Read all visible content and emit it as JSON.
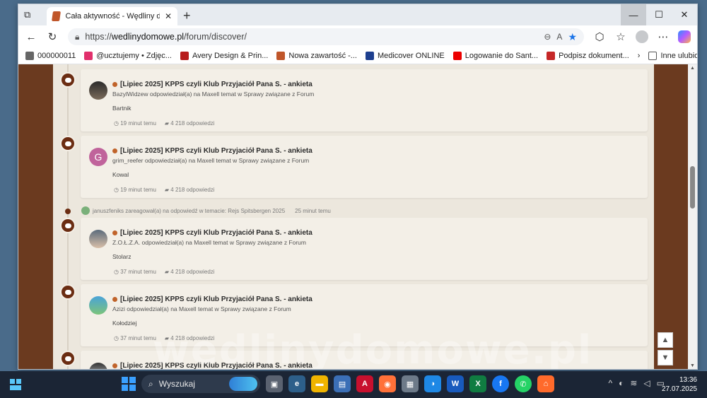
{
  "tab": {
    "title": "Cała aktywność - Wędliny domowe",
    "close": "✕",
    "new": "+"
  },
  "window_controls": {
    "minimize": "—",
    "maximize": "☐",
    "close": "✕"
  },
  "address": {
    "url_prefix": "https://",
    "url_domain": "wedlinydomowe.pl",
    "url_path": "/forum/discover/"
  },
  "bookmarks": [
    {
      "label": "000000011",
      "color": "#666"
    },
    {
      "label": "@ucztujemy • Zdjęc...",
      "color": "#e1306c"
    },
    {
      "label": "Avery Design & Prin...",
      "color": "#b71c1c"
    },
    {
      "label": "Nowa zawartość -...",
      "color": "#c0562a"
    },
    {
      "label": "Medicover ONLINE",
      "color": "#1d3f8f"
    },
    {
      "label": "Logowanie do Sant...",
      "color": "#ec0000"
    },
    {
      "label": "Podpisz dokument...",
      "color": "#c62828"
    }
  ],
  "bookmarks_more": "Inne ulubione",
  "feed": [
    {
      "title": "[Lipiec 2025] KPPS czyli Klub Przyjaciół Pana S. - ankieta",
      "actor": "BazylWidzew odpowiedział(a) na Maxell temat w Sprawy związane z Forum",
      "body": "Bartnik",
      "time": "19 minut temu",
      "replies": "4 218 odpowiedzi",
      "avatar": "photo1",
      "letter": ""
    },
    {
      "title": "[Lipiec 2025] KPPS czyli Klub Przyjaciół Pana S. - ankieta",
      "actor": "grim_reefer odpowiedział(a) na Maxell temat w Sprawy związane z Forum",
      "body": "Kowal",
      "time": "19 minut temu",
      "replies": "4 218 odpowiedzi",
      "avatar": "letter",
      "letter": "G"
    },
    {
      "title": "[Lipiec 2025] KPPS czyli Klub Przyjaciół Pana S. - ankieta",
      "actor": "Z.O.Ł.Z.A. odpowiedział(a) na Maxell temat w Sprawy związane z Forum",
      "body": "Stolarz",
      "time": "37 minut temu",
      "replies": "4 218 odpowiedzi",
      "avatar": "photo2",
      "letter": ""
    },
    {
      "title": "[Lipiec 2025] KPPS czyli Klub Przyjaciół Pana S. - ankieta",
      "actor": "Azizi odpowiedział(a) na Maxell temat w Sprawy związane z Forum",
      "body": "Kołodziej",
      "time": "37 minut temu",
      "replies": "4 218 odpowiedzi",
      "avatar": "photo3",
      "letter": ""
    },
    {
      "title": "[Lipiec 2025] KPPS czyli Klub Przyjaciół Pana S. - ankieta",
      "actor": "",
      "body": "",
      "time": "",
      "replies": "",
      "avatar": "photo4",
      "letter": ""
    }
  ],
  "mini_activity": {
    "text": "januszfeniks zareagował(a) na odpowiedź w temacie: Rejs Spitsbergen 2025",
    "time": "25 minut temu"
  },
  "watermark": "wedlinydomowe.pl",
  "taskbar": {
    "search_label": "Wyszukaj",
    "time": "13:36",
    "date": "27.07.2025"
  },
  "scroll_buttons": {
    "up": "▲",
    "down": "▼"
  }
}
